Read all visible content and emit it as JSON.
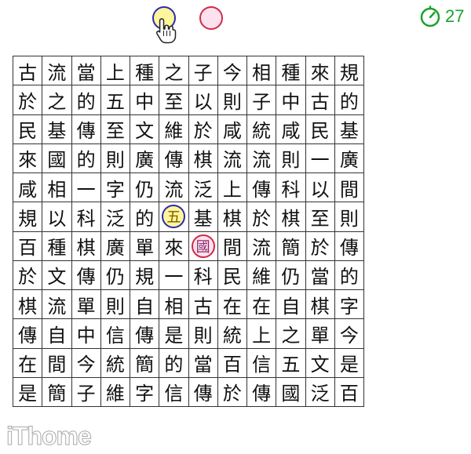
{
  "tokens": [
    {
      "id": "token-yellow",
      "fill": "#fff59a",
      "border": "#2b2bb0"
    },
    {
      "id": "token-pink",
      "fill": "#fde2ee",
      "border": "#d12a4a"
    }
  ],
  "cursor": {
    "icon": "hand-pointer-icon"
  },
  "timer": {
    "icon": "stopwatch-icon",
    "value": "27",
    "color": "#1aa32a"
  },
  "board": {
    "rows": [
      [
        "古",
        "流",
        "當",
        "上",
        "種",
        "之",
        "子",
        "今",
        "相",
        "種",
        "來",
        "規"
      ],
      [
        "於",
        "之",
        "的",
        "五",
        "中",
        "至",
        "以",
        "則",
        "子",
        "中",
        "古",
        "的"
      ],
      [
        "民",
        "基",
        "傳",
        "至",
        "文",
        "維",
        "於",
        "咸",
        "統",
        "咸",
        "民",
        "基"
      ],
      [
        "來",
        "國",
        "的",
        "則",
        "廣",
        "傳",
        "棋",
        "流",
        "流",
        "則",
        "一",
        "廣"
      ],
      [
        "咸",
        "相",
        "一",
        "字",
        "仍",
        "流",
        "泛",
        "上",
        "傳",
        "科",
        "以",
        "間"
      ],
      [
        "規",
        "以",
        "科",
        "泛",
        "的",
        "五",
        "基",
        "棋",
        "於",
        "棋",
        "至",
        "則"
      ],
      [
        "百",
        "種",
        "棋",
        "廣",
        "單",
        "來",
        "國",
        "間",
        "流",
        "簡",
        "於",
        "傳"
      ],
      [
        "於",
        "文",
        "傳",
        "仍",
        "規",
        "一",
        "科",
        "民",
        "維",
        "仍",
        "當",
        "的"
      ],
      [
        "棋",
        "流",
        "單",
        "則",
        "自",
        "相",
        "古",
        "在",
        "在",
        "自",
        "棋",
        "字"
      ],
      [
        "傳",
        "自",
        "中",
        "信",
        "傳",
        "是",
        "則",
        "統",
        "上",
        "之",
        "單",
        "今"
      ],
      [
        "在",
        "間",
        "今",
        "統",
        "簡",
        "的",
        "當",
        "百",
        "信",
        "五",
        "文",
        "是"
      ],
      [
        "是",
        "簡",
        "子",
        "維",
        "字",
        "信",
        "傳",
        "於",
        "傳",
        "國",
        "泛",
        "百"
      ]
    ],
    "marks": [
      {
        "row": 5,
        "col": 5,
        "fill": "#fff59a",
        "border": "#2b2bb0",
        "color": "#7a5a00"
      },
      {
        "row": 6,
        "col": 6,
        "fill": "#fde2ee",
        "border": "#d12a4a",
        "color": "#8a2a6a"
      }
    ]
  },
  "watermark": "iThome"
}
